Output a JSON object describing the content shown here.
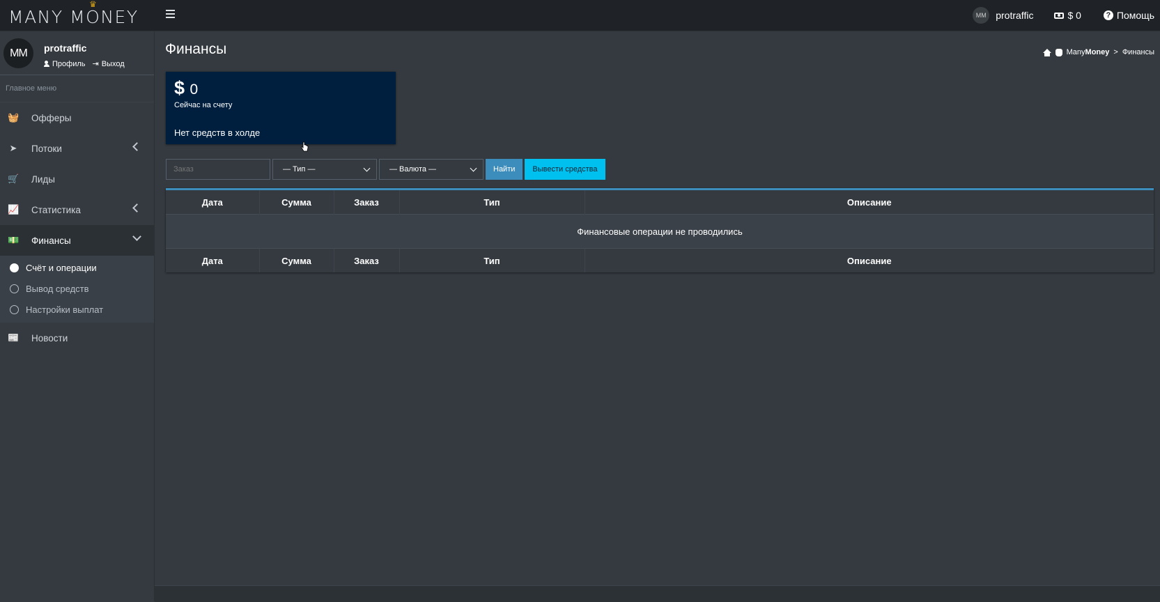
{
  "app": {
    "logo_text": "MANY MONEY",
    "crown_glyph": "♛"
  },
  "topbar": {
    "avatar_initials": "MM",
    "username": "protraffic",
    "balance": "$ 0",
    "help_label": "Помощь",
    "icons": [
      "hamburger-icon",
      "money-icon",
      "help-icon"
    ]
  },
  "sidebar": {
    "avatar_initials": "MM",
    "username": "protraffic",
    "profile_link": "Профиль",
    "logout_link": "Выход",
    "menu_header": "Главное меню",
    "items": [
      {
        "label": "Офферы",
        "icon": "basket-icon",
        "glyph": "🧺"
      },
      {
        "label": "Потоки",
        "icon": "paper-plane-icon",
        "glyph": "➤"
      },
      {
        "label": "Лиды",
        "icon": "cart-icon",
        "glyph": "🛒"
      },
      {
        "label": "Статистика",
        "icon": "chart-icon",
        "glyph": "📈"
      },
      {
        "label": "Финансы",
        "icon": "money-icon",
        "glyph": "💵"
      },
      {
        "label": "Новости",
        "icon": "newspaper-icon",
        "glyph": "📰"
      }
    ],
    "finance_sub": [
      {
        "label": "Счёт и операции",
        "active": true
      },
      {
        "label": "Вывод средств",
        "active": false
      },
      {
        "label": "Настройки выплат",
        "active": false
      }
    ]
  },
  "page": {
    "title": "Финансы",
    "breadcrumb_site_plain": "Many",
    "breadcrumb_site_bold": "Money",
    "breadcrumb_sep": ">",
    "breadcrumb_current": "Финансы"
  },
  "balance_card": {
    "currency": "$",
    "amount": "0",
    "label": "Сейчас на счету",
    "hold_text": "Нет средств в холде",
    "bg_color": "#001f3f"
  },
  "filters": {
    "order_placeholder": "Заказ",
    "type_select": "— Тип —",
    "currency_select": "— Валюта —",
    "find_button": "Найти",
    "withdraw_button": "Вывести средства"
  },
  "table": {
    "columns": [
      "Дата",
      "Сумма",
      "Заказ",
      "Тип",
      "Описание"
    ],
    "empty_message": "Финансовые операции не проводились"
  },
  "colors": {
    "primary": "#3c8dbc",
    "info": "#00c0ef",
    "bg": "#343a40",
    "topbar": "#1f2327"
  }
}
